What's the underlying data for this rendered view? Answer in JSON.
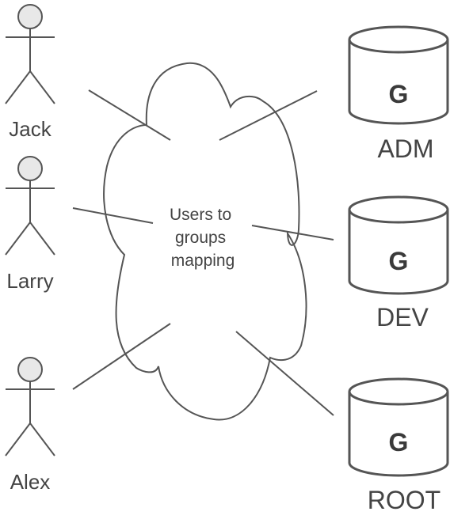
{
  "cloud": {
    "lines": [
      "Users to",
      "groups",
      "mapping"
    ]
  },
  "actors": [
    {
      "name": "Jack"
    },
    {
      "name": "Larry"
    },
    {
      "name": "Alex"
    }
  ],
  "groups": [
    {
      "name": "ADM",
      "icon_letter": "G"
    },
    {
      "name": "DEV",
      "icon_letter": "G"
    },
    {
      "name": "ROOT",
      "icon_letter": "G"
    }
  ],
  "colors": {
    "stroke": "#555555",
    "head_fill": "#e8e8e8",
    "text": "#444444"
  }
}
